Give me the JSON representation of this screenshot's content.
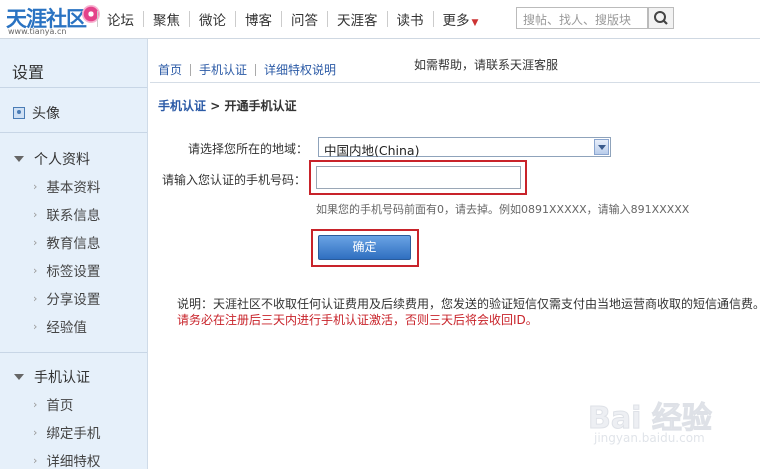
{
  "header": {
    "logo_text": "天涯社区",
    "logo_url": "www.tianya.cn",
    "nav": [
      "论坛",
      "聚焦",
      "微论",
      "博客",
      "问答",
      "天涯客",
      "读书",
      "更多"
    ],
    "search_placeholder": "搜帖、找人、搜版块"
  },
  "sidebar": {
    "title": "设置",
    "avatar": "头像",
    "group_profile": "个人资料",
    "profile_items": [
      "基本资料",
      "联系信息",
      "教育信息",
      "标签设置",
      "分享设置",
      "经验值"
    ],
    "group_phone": "手机认证",
    "phone_items": [
      "首页",
      "绑定手机",
      "详细特权"
    ]
  },
  "main": {
    "tabs": [
      "首页",
      "手机认证",
      "详细特权说明"
    ],
    "help_text": "如需帮助，请联系天涯客服",
    "breadcrumb_link": "手机认证",
    "breadcrumb_sep": " > ",
    "breadcrumb_current": "开通手机认证",
    "region_label": "请选择您所在的地域：",
    "region_value": "中国内地(China)",
    "phone_label": "请输入您认证的手机号码：",
    "phone_value": "",
    "hint": "如果您的手机号码前面有0，请去掉。例如0891XXXXX，请输入891XXXXX",
    "submit_label": "确定",
    "note": "说明：天涯社区不收取任何认证费用及后续费用，您发送的验证短信仅需支付由当地运营商收取的短信通信费。",
    "warning": "请务必在注册后三天内进行手机认证激活，否则三天后将会收回ID。"
  },
  "watermark": {
    "text": "Bai 经验",
    "sub": "jingyan.baidu.com"
  },
  "colors": {
    "link": "#2b5aa6",
    "highlight": "#c8232a",
    "sidebar_bg": "#e6f0fa",
    "button": "#2f6fc0"
  }
}
